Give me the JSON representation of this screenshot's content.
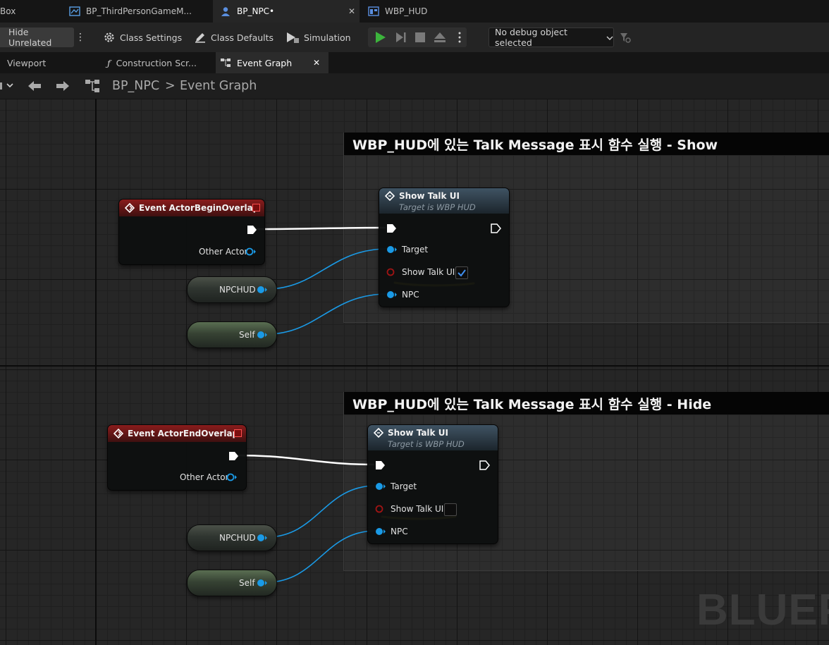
{
  "doc_tabs": [
    {
      "label": "Box"
    },
    {
      "label": "BP_ThirdPersonGameM..."
    },
    {
      "label": "BP_NPC•",
      "active": true
    },
    {
      "label": "WBP_HUD"
    }
  ],
  "toolbar": {
    "hide_unrelated": "Hide Unrelated",
    "class_settings": "Class Settings",
    "class_defaults": "Class Defaults",
    "simulation": "Simulation",
    "debug_object": "No debug object selected",
    "play_color": "#3cb43c"
  },
  "panel_tabs": [
    {
      "label": "Viewport"
    },
    {
      "label": "Construction Scr..."
    },
    {
      "label": "Event Graph",
      "active": true
    }
  ],
  "breadcrumb": {
    "blueprint": "BP_NPC",
    "separator": ">",
    "graph": "Event Graph"
  },
  "comments": [
    {
      "title": "WBP_HUD에 있는 Talk Message 표시 함수 실행 - Show"
    },
    {
      "title": "WBP_HUD에 있는 Talk Message 표시 함수 실행 - Hide"
    }
  ],
  "nodes": {
    "begin_overlap": {
      "title": "Event ActorBeginOverlap",
      "pin_other": "Other Actor"
    },
    "end_overlap": {
      "title": "Event ActorEndOverlap",
      "pin_other": "Other Actor"
    },
    "show_node_1": {
      "title": "Show Talk UI",
      "subtitle": "Target is WBP HUD",
      "pin_target": "Target",
      "pin_bool": "Show Talk UI",
      "pin_npc": "NPC",
      "checked": true
    },
    "show_node_2": {
      "title": "Show Talk UI",
      "subtitle": "Target is WBP HUD",
      "pin_target": "Target",
      "pin_bool": "Show Talk UI",
      "pin_npc": "NPC",
      "checked": false
    },
    "npchud_1": {
      "label": "NPCHUD"
    },
    "self_1": {
      "label": "Self"
    },
    "npchud_2": {
      "label": "NPCHUD"
    },
    "self_2": {
      "label": "Self"
    }
  },
  "colors": {
    "object_pin": "#1a9ae6",
    "bool_pin": "#8f1010",
    "event_header": "#8a1c1c",
    "function_header": "#3f5363",
    "highlight": "#f5e61a"
  },
  "watermark": "BLUEPRINT"
}
